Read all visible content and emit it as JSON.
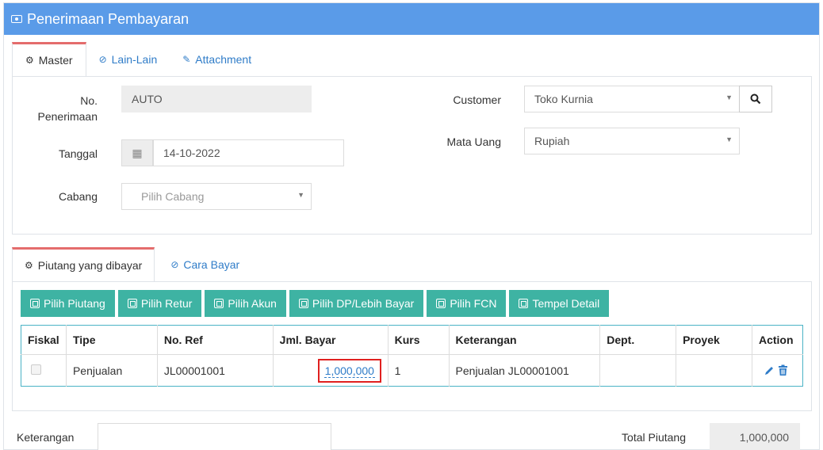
{
  "header": {
    "title": "Penerimaan Pembayaran",
    "icon": "money-icon"
  },
  "top_tabs": [
    {
      "label": "Master",
      "icon": "cogs-icon",
      "active": true
    },
    {
      "label": "Lain-Lain",
      "icon": "check-circle-icon",
      "active": false
    },
    {
      "label": "Attachment",
      "icon": "paperclip-icon",
      "active": false
    }
  ],
  "form": {
    "no_penerimaan_label_1": "No.",
    "no_penerimaan_label_2": "Penerimaan",
    "no_penerimaan_value": "AUTO",
    "tanggal_label": "Tanggal",
    "tanggal_value": "14-10-2022",
    "cabang_label": "Cabang",
    "cabang_placeholder": "Pilih Cabang",
    "customer_label": "Customer",
    "customer_value": "Toko Kurnia",
    "mata_uang_label": "Mata Uang",
    "mata_uang_value": "Rupiah"
  },
  "detail_tabs": [
    {
      "label": "Piutang yang dibayar",
      "icon": "cogs-icon",
      "active": true
    },
    {
      "label": "Cara Bayar",
      "icon": "check-circle-icon",
      "active": false
    }
  ],
  "buttons": [
    "Pilih Piutang",
    "Pilih Retur",
    "Pilih Akun",
    "Pilih DP/Lebih Bayar",
    "Pilih FCN",
    "Tempel Detail"
  ],
  "table": {
    "columns": [
      "Fiskal",
      "Tipe",
      "No. Ref",
      "Jml. Bayar",
      "Kurs",
      "Keterangan",
      "Dept.",
      "Proyek",
      "Action"
    ],
    "rows": [
      {
        "tipe": "Penjualan",
        "no_ref": "JL00001001",
        "jml_bayar": "1,000,000",
        "kurs": "1",
        "keterangan": "Penjualan JL00001001",
        "dept": "",
        "proyek": ""
      }
    ]
  },
  "footer": {
    "keterangan_label": "Keterangan",
    "total_piutang_label": "Total Piutang",
    "total_piutang_value": "1,000,000"
  },
  "colors": {
    "header": "#5a9be8",
    "button": "#3eb3a3",
    "tab_accent": "#e46c6c",
    "link": "#2f7cc8",
    "highlight": "#e0201f"
  }
}
